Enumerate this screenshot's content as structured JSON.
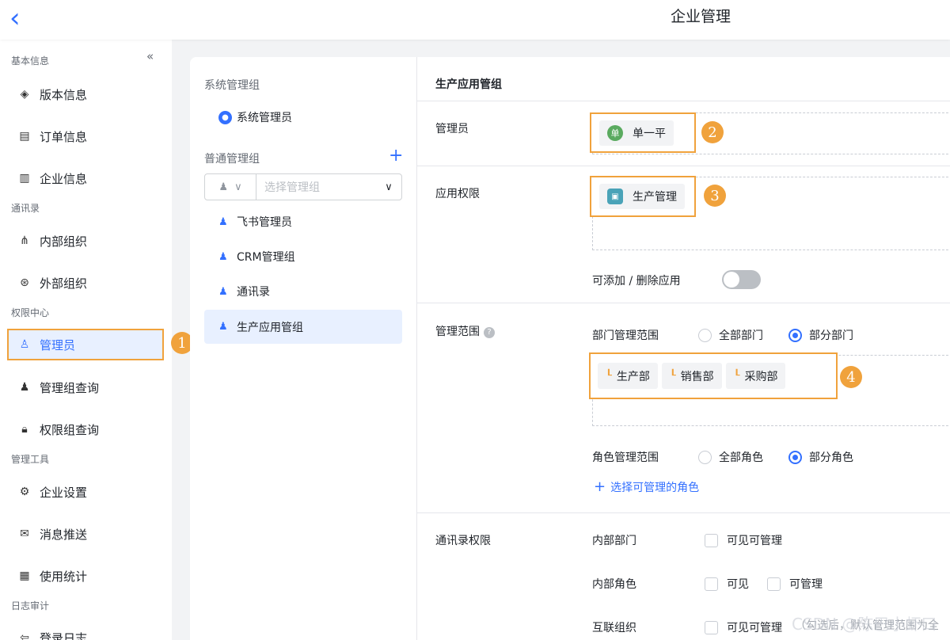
{
  "header": {
    "back_icon": "‹",
    "title": "企业管理"
  },
  "sidebar": {
    "collapse_icon": "«",
    "sections": {
      "basic": "基本信息",
      "contacts": "通讯录",
      "permission": "权限中心",
      "tools": "管理工具",
      "audit": "日志审计"
    },
    "items": [
      {
        "icon": "layers-icon",
        "glyph": "◈",
        "label": "版本信息"
      },
      {
        "icon": "clipboard-icon",
        "glyph": "▤",
        "label": "订单信息"
      },
      {
        "icon": "building-icon",
        "glyph": "▥",
        "label": "企业信息"
      },
      {
        "icon": "org-tree-icon",
        "glyph": "⋔",
        "label": "内部组织"
      },
      {
        "icon": "external-org-icon",
        "glyph": "⊛",
        "label": "外部组织"
      },
      {
        "icon": "admin-user-icon",
        "glyph": "♙",
        "label": "管理员"
      },
      {
        "icon": "group-query-icon",
        "glyph": "♟",
        "label": "管理组查询"
      },
      {
        "icon": "lock-icon",
        "glyph": "🔒︎",
        "label": "权限组查询"
      },
      {
        "icon": "gear-icon",
        "glyph": "⚙",
        "label": "企业设置"
      },
      {
        "icon": "message-icon",
        "glyph": "✉",
        "label": "消息推送"
      },
      {
        "icon": "stats-icon",
        "glyph": "▦",
        "label": "使用统计"
      },
      {
        "icon": "login-log-icon",
        "glyph": "⇦",
        "label": "登录日志"
      }
    ]
  },
  "annotations": [
    "1",
    "2",
    "3",
    "4"
  ],
  "groups": {
    "system_title": "系统管理组",
    "system_admin": "系统管理员",
    "normal_title": "普通管理组",
    "add_icon": "+",
    "select_placeholder": "选择管理组",
    "list": [
      "飞书管理员",
      "CRM管理组",
      "通讯录",
      "生产应用管组"
    ]
  },
  "detail": {
    "title": "生产应用管组",
    "admin_label": "管理员",
    "admin_avatar": "单",
    "admin_name": "单一平",
    "app_label": "应用权限",
    "app_name": "生产管理",
    "toggle_label": "可添加 / 删除应用",
    "scope_label": "管理范围",
    "scope_help": "?",
    "dept_scope_label": "部门管理范围",
    "all_depts": "全部部门",
    "part_depts": "部分部门",
    "depts": [
      "生产部",
      "销售部",
      "采购部"
    ],
    "role_scope_label": "角色管理范围",
    "all_roles": "全部角色",
    "part_roles": "部分角色",
    "select_roles": "选择可管理的角色",
    "contacts_label": "通讯录权限",
    "internal_dept": "内部部门",
    "visible_manageable": "可见可管理",
    "internal_role": "内部角色",
    "visible": "可见",
    "manageable": "可管理",
    "linked_org": "互联组织",
    "linked_visible_manageable": "可见可管理",
    "hint": "（勾选后，默认管理范围为全"
  },
  "watermark": "CSDN @陈巴小虾口"
}
